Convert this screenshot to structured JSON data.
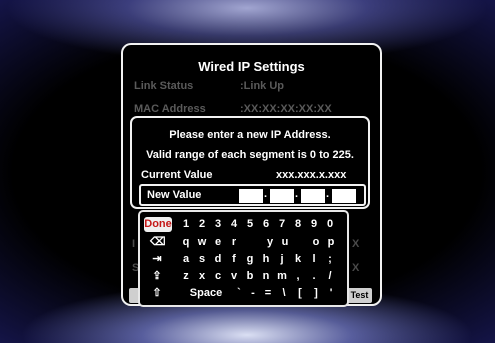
{
  "settings": {
    "title": "Wired IP Settings",
    "link_status_label": "Link Status",
    "link_status_value": ":Link Up",
    "mac_label": "MAC Address",
    "mac_value": ":XX:XX:XX:XX:XX",
    "hidden_row_1_char": "I",
    "hidden_row_2_char": "S",
    "hidden_value_1_char": "X",
    "hidden_value_2_char": "X",
    "test_button_label": "Test"
  },
  "dialog": {
    "line1": "Please enter a new IP Address.",
    "line2": "Valid range of each segment is 0 to 225.",
    "current_label": "Current Value",
    "current_value": "xxx.xxx.x.xxx",
    "new_label": "New Value",
    "dot": "."
  },
  "keyboard": {
    "done": "Done",
    "row1": [
      "1",
      "2",
      "3",
      "4",
      "5",
      "6",
      "7",
      "8",
      "9",
      "0"
    ],
    "row2": [
      "⌫",
      "q",
      "w",
      "e",
      "r",
      "",
      "y",
      "u",
      "",
      "o",
      "p"
    ],
    "row3": [
      "⇥",
      "a",
      "s",
      "d",
      "f",
      "g",
      "h",
      "j",
      "k",
      "l",
      ";"
    ],
    "row4": [
      "⇪",
      "z",
      "x",
      "c",
      "v",
      "b",
      "n",
      "m",
      ",",
      ".",
      "/"
    ],
    "row5": [
      "⇧",
      "Space",
      "`",
      "-",
      "=",
      "\\",
      "[",
      "]",
      "'"
    ]
  },
  "colors": {
    "done_text": "#c51818",
    "panel_border": "#f2f2f2",
    "glow": "#8c96f0"
  }
}
